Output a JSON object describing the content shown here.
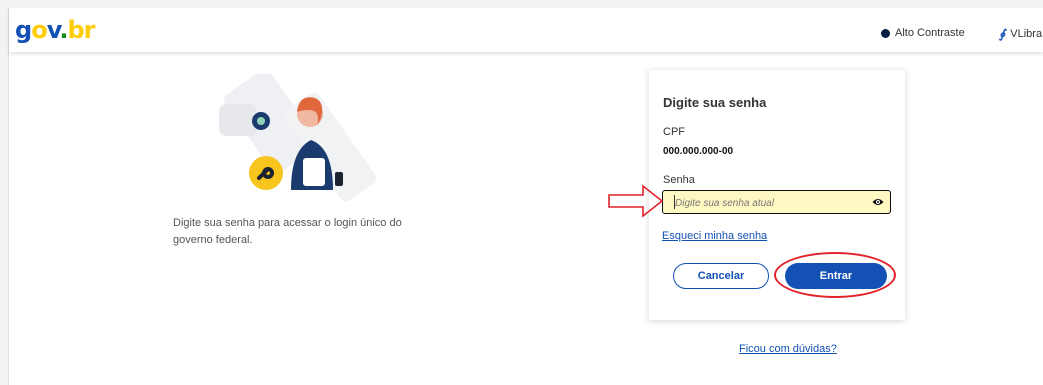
{
  "header": {
    "logo": {
      "g": "g",
      "o": "o",
      "v": "v",
      "dot": ".",
      "br": "br"
    },
    "contrast_label": "Alto Contraste",
    "vlibras_label": "VLibra"
  },
  "intro": {
    "text": "Digite sua senha para acessar o login único do governo federal."
  },
  "form": {
    "title": "Digite sua senha",
    "cpf_label": "CPF",
    "cpf_value": "000.000.000-00",
    "password_label": "Senha",
    "password_value": "",
    "password_placeholder": "Digite sua senha atual",
    "forgot_link": "Esqueci minha senha",
    "cancel_label": "Cancelar",
    "submit_label": "Entrar"
  },
  "doubts_link": "Ficou com dúvidas?",
  "colors": {
    "brand_blue": "#1351b4",
    "brand_yellow": "#ffcd07",
    "brand_green": "#168821",
    "field_highlight": "#fff8c2",
    "annotation_red": "#e1222a"
  },
  "icons": {
    "contrast": "half-circle-contrast-icon",
    "vlibras": "hands-sign-language-icon",
    "password_toggle": "eye-icon",
    "annotation_arrow": "right-arrow-outline",
    "annotation_ring": "red-ellipse-highlight"
  }
}
